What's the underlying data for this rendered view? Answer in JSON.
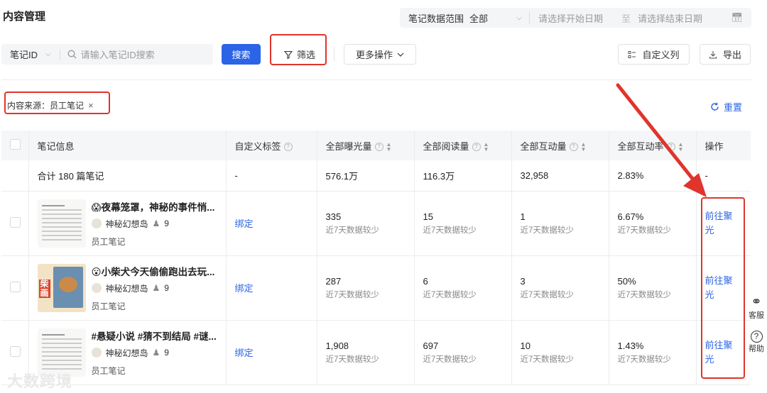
{
  "page_title": "内容管理",
  "date_range": {
    "label": "笔记数据范围",
    "value": "全部",
    "start_placeholder": "请选择开始日期",
    "to": "至",
    "end_placeholder": "请选择结束日期"
  },
  "search": {
    "field": "笔记ID",
    "placeholder": "请输入笔记ID搜索",
    "button": "搜索"
  },
  "toolbar": {
    "filter": "筛选",
    "more": "更多操作",
    "columns": "自定义列",
    "export": "导出"
  },
  "active_filter": "内容来源：员工笔记",
  "reset": "重置",
  "table": {
    "headers": [
      "笔记信息",
      "自定义标签",
      "全部曝光量",
      "全部阅读量",
      "全部互动量",
      "全部互动率",
      "操作"
    ],
    "summary": {
      "label": "合计 180 篇笔记",
      "tag": "-",
      "exposure": "576.1万",
      "reads": "116.3万",
      "interactions": "32,958",
      "rate": "2.83%",
      "op": "-"
    },
    "rows": [
      {
        "title": "😱夜幕笼罩，神秘的事件悄...",
        "author": "神秘幻想岛",
        "count": "9",
        "source": "员工笔记",
        "tag": "绑定",
        "exposure": "335",
        "reads": "15",
        "interactions": "1",
        "rate": "6.67%",
        "sub": "近7天数据较少",
        "op": "前往聚光"
      },
      {
        "title": "😮小柴犬今天偷偷跑出去玩...",
        "author": "神秘幻想岛",
        "count": "9",
        "source": "员工笔记",
        "tag": "绑定",
        "exposure": "287",
        "reads": "6",
        "interactions": "3",
        "rate": "50%",
        "sub": "近7天数据较少",
        "op": "前往聚光"
      },
      {
        "title": "#悬疑小说 #猜不到结局 #谜...",
        "author": "神秘幻想岛",
        "count": "9",
        "source": "员工笔记",
        "tag": "绑定",
        "exposure": "1,908",
        "reads": "697",
        "interactions": "10",
        "rate": "1.43%",
        "sub": "近7天数据较少",
        "op": "前往聚光"
      }
    ]
  },
  "side": {
    "service": "客服",
    "help": "帮助"
  },
  "watermark": "大数跨境",
  "colors": {
    "accent": "#2b64e6",
    "highlight": "#e0342c"
  }
}
